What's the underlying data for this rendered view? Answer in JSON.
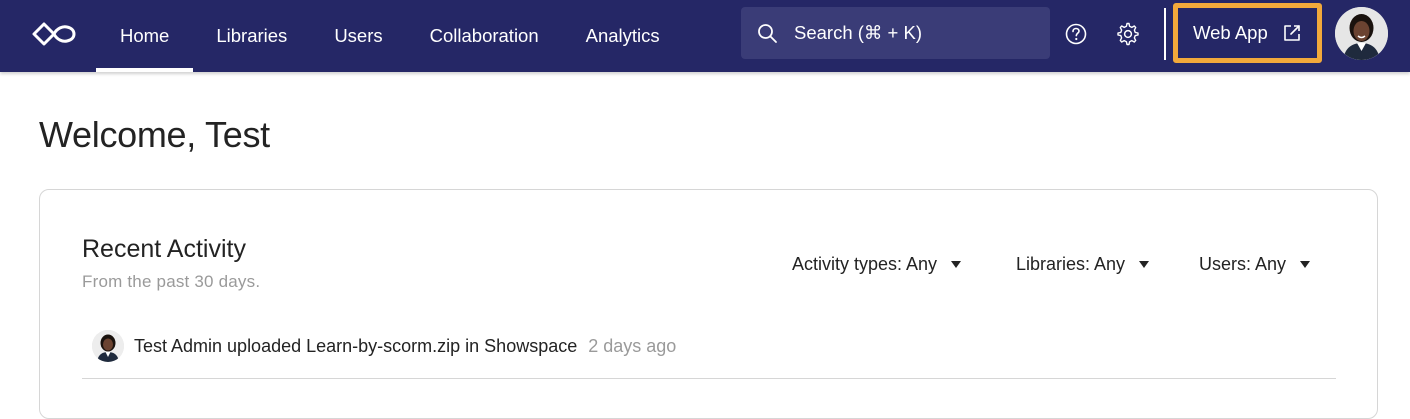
{
  "header": {
    "nav": [
      {
        "label": "Home",
        "active": true
      },
      {
        "label": "Libraries",
        "active": false
      },
      {
        "label": "Users",
        "active": false
      },
      {
        "label": "Collaboration",
        "active": false
      },
      {
        "label": "Analytics",
        "active": false
      }
    ],
    "search_label": "Search (⌘ + K)",
    "web_app_label": "Web App",
    "icons": [
      "infinity-logo-icon",
      "search-icon",
      "help-icon",
      "gear-icon",
      "external-link-icon"
    ],
    "colors": {
      "nav_bg": "#252766",
      "search_bg": "#3a3c77",
      "highlight": "#f2a93b"
    }
  },
  "main": {
    "welcome": "Welcome, Test",
    "recent_activity": {
      "title": "Recent Activity",
      "subtitle": "From the past 30 days.",
      "filters": {
        "activity_types": "Activity types: Any",
        "libraries": "Libraries: Any",
        "users": "Users: Any"
      },
      "items": [
        {
          "text": "Test Admin uploaded Learn-by-scorm.zip in Showspace",
          "time": "2 days ago"
        }
      ]
    }
  }
}
